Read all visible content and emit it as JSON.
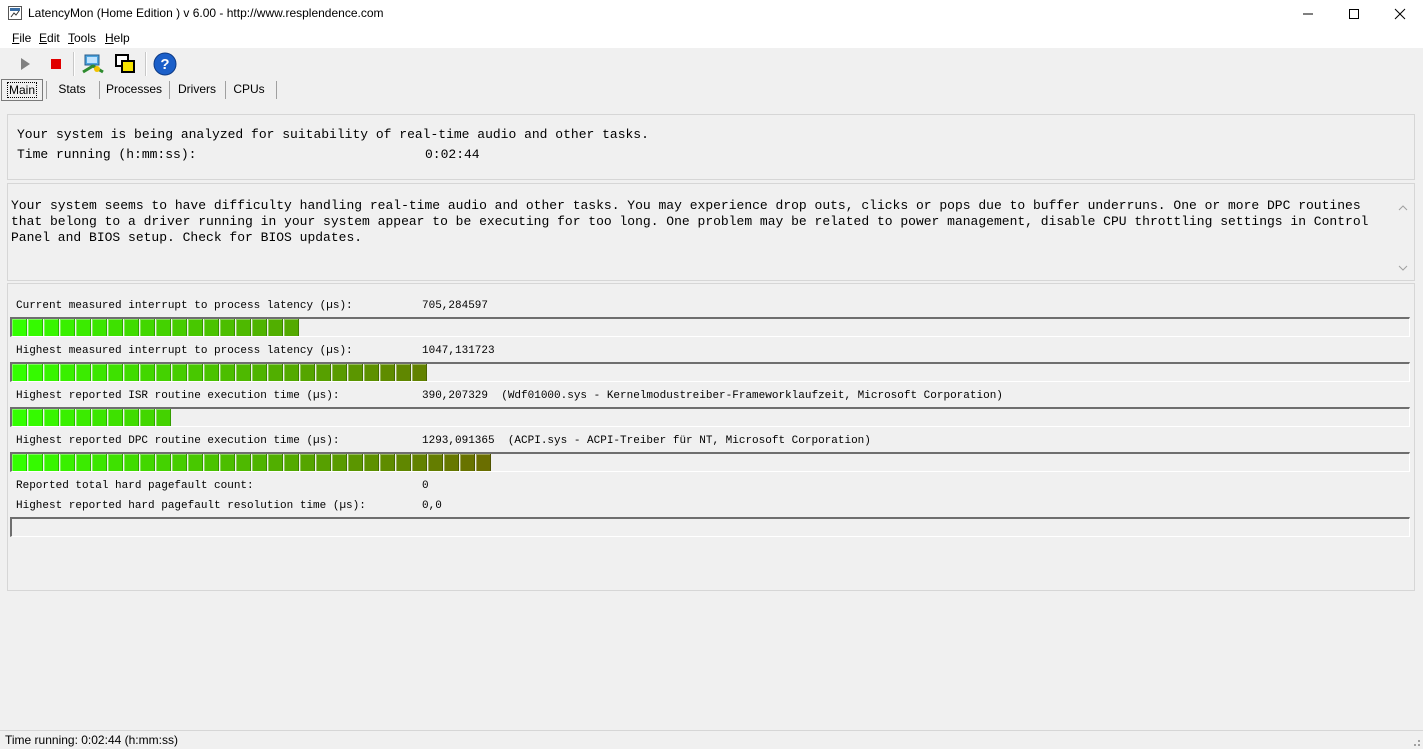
{
  "window": {
    "title": "LatencyMon  (Home Edition )  v 6.00 - http://www.resplendence.com",
    "controls": [
      "minimize",
      "maximize",
      "close"
    ]
  },
  "menu": {
    "file": "F",
    "file_rest": "ile",
    "edit": "E",
    "edit_rest": "dit",
    "tools": "T",
    "tools_rest": "ools",
    "help": "H",
    "help_rest": "elp"
  },
  "toolbar": {
    "icons": [
      "play-icon",
      "stop-icon",
      "analyze-icon",
      "windows-icon",
      "help-icon"
    ],
    "colors": {
      "stop": "#e00000",
      "play": "#808080",
      "help": "#1b5fc9"
    }
  },
  "tabs": [
    {
      "label": "Main",
      "active": true
    },
    {
      "label": "Stats",
      "active": false
    },
    {
      "label": "Processes",
      "active": false
    },
    {
      "label": "Drivers",
      "active": false
    },
    {
      "label": "CPUs",
      "active": false
    }
  ],
  "status_panel": {
    "line1": "Your system is being analyzed for suitability of real-time audio and other tasks.",
    "time_label": "Time running (h:mm:ss):",
    "time_value": "0:02:44"
  },
  "message": "Your system seems to have difficulty handling real-time audio and other tasks. You may experience drop outs, clicks or pops due to buffer underruns. One or more DPC routines that belong to a driver running in your system appear to be executing for too long. One problem may be related to power management, disable CPU throttling settings in Control Panel and BIOS setup. Check for BIOS updates.",
  "metrics": [
    {
      "label": "Current measured interrupt to process latency (µs):",
      "value": "705,284597",
      "bar_fraction": 0.204
    },
    {
      "label": "Highest measured interrupt to process latency (µs):",
      "value": "1047,131723",
      "bar_fraction": 0.296
    },
    {
      "label": "Highest reported ISR routine execution time (µs):",
      "value": "390,207329  (Wdf01000.sys - Kernelmodustreiber-Frameworklaufzeit, Microsoft Corporation)",
      "bar_fraction": 0.113
    },
    {
      "label": "Highest reported DPC routine execution time (µs):",
      "value": "1293,091365  (ACPI.sys - ACPI-Treiber für NT, Microsoft Corporation)",
      "bar_fraction": 0.342
    },
    {
      "label": "Reported total hard pagefault count:",
      "value": "0"
    },
    {
      "label": "Highest reported hard pagefault resolution time (µs):",
      "value": "0,0",
      "bar_fraction": 0
    }
  ],
  "bar_colors": {
    "start": "#33ff00",
    "end": "#6b6b00"
  },
  "statusbar": {
    "text": "Time running: 0:02:44  (h:mm:ss)"
  }
}
